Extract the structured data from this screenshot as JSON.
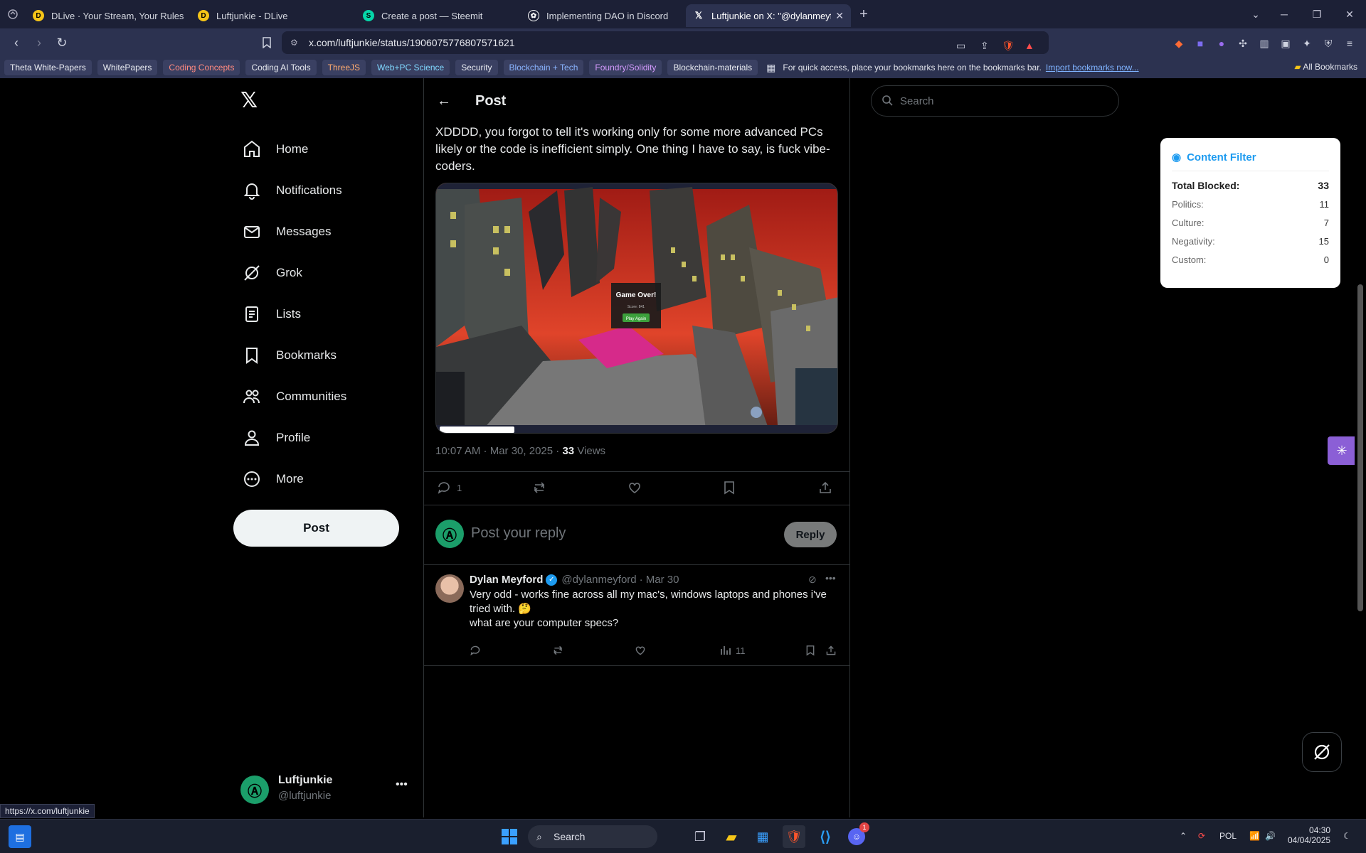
{
  "browser": {
    "tabs": [
      {
        "title": "DLive · Your Stream, Your Rules",
        "icon": "dlive-icon",
        "color": "#f5c518"
      },
      {
        "title": "Luftjunkie - DLive",
        "icon": "dlive-icon",
        "color": "#f5c518"
      },
      {
        "title": "Create a post — Steemit",
        "icon": "steemit-icon",
        "color": "#06d6a9"
      },
      {
        "title": "Implementing DAO in Discord",
        "icon": "openai-icon",
        "color": "#ffffff"
      },
      {
        "title": "Luftjunkie on X: \"@dylanmeyford",
        "icon": "x-icon",
        "color": "#ffffff"
      }
    ],
    "url": "x.com/luftjunkie/status/1906075776807571621",
    "bookmarks": [
      {
        "label": "Theta White-Papers",
        "color": "#e8eaf0"
      },
      {
        "label": "WhitePapers",
        "color": "#e8eaf0"
      },
      {
        "label": "Coding Concepts",
        "color": "#ff8a80"
      },
      {
        "label": "Coding AI Tools",
        "color": "#e8eaf0"
      },
      {
        "label": "ThreeJS",
        "color": "#ffab70"
      },
      {
        "label": "Web+PC Science",
        "color": "#80d8ff"
      },
      {
        "label": "Security",
        "color": "#e8eaf0"
      },
      {
        "label": "Blockchain + Tech",
        "color": "#8ab4ff"
      },
      {
        "label": "Foundry/Solidity",
        "color": "#d59bff"
      },
      {
        "label": "Blockchain-materials",
        "color": "#e8eaf0"
      }
    ],
    "bookmarks_message": "For quick access, place your bookmarks here on the bookmarks bar.",
    "bookmarks_import": "Import bookmarks now...",
    "all_bookmarks": "All Bookmarks",
    "status_url": "https://x.com/luftjunkie"
  },
  "nav": {
    "items": [
      {
        "label": "Home",
        "icon": "home-icon"
      },
      {
        "label": "Notifications",
        "icon": "bell-icon"
      },
      {
        "label": "Messages",
        "icon": "envelope-icon"
      },
      {
        "label": "Grok",
        "icon": "grok-icon"
      },
      {
        "label": "Lists",
        "icon": "list-icon"
      },
      {
        "label": "Bookmarks",
        "icon": "bookmark-icon"
      },
      {
        "label": "Communities",
        "icon": "people-icon"
      },
      {
        "label": "Profile",
        "icon": "person-icon"
      },
      {
        "label": "More",
        "icon": "more-circle-icon"
      }
    ],
    "post_button": "Post",
    "account": {
      "name": "Luftjunkie",
      "handle": "@luftjunkie"
    }
  },
  "post": {
    "header": "Post",
    "text": "XDDDD, you forgot to tell it's working only for some more advanced PCs likely or the code is inefficient simply. One thing I have to say, is fuck vibe-coders.",
    "media": {
      "overlay_title": "Game Over!",
      "overlay_score": "Score: 841",
      "overlay_button": "Play Again"
    },
    "time": "10:07 AM · Mar 30, 2025",
    "views_count": "33",
    "views_label": "Views",
    "reply_count": "1",
    "reply_placeholder": "Post your reply",
    "reply_button": "Reply"
  },
  "reply": {
    "name": "Dylan Meyford",
    "handle": "@dylanmeyford",
    "date": "· Mar 30",
    "line1": "Very odd - works fine across all my mac's, windows laptops and phones i've tried with. 🤔",
    "line2": "what are your computer specs?",
    "views": "11"
  },
  "search": {
    "placeholder": "Search"
  },
  "content_filter": {
    "title": "Content Filter",
    "total_label": "Total Blocked:",
    "total": "33",
    "rows": [
      {
        "label": "Politics:",
        "value": "11"
      },
      {
        "label": "Culture:",
        "value": "7"
      },
      {
        "label": "Negativity:",
        "value": "15"
      },
      {
        "label": "Custom:",
        "value": "0"
      }
    ]
  },
  "taskbar": {
    "search": "Search",
    "language": "POL",
    "time": "04:30",
    "date": "04/04/2025",
    "discord_badge": "1"
  }
}
